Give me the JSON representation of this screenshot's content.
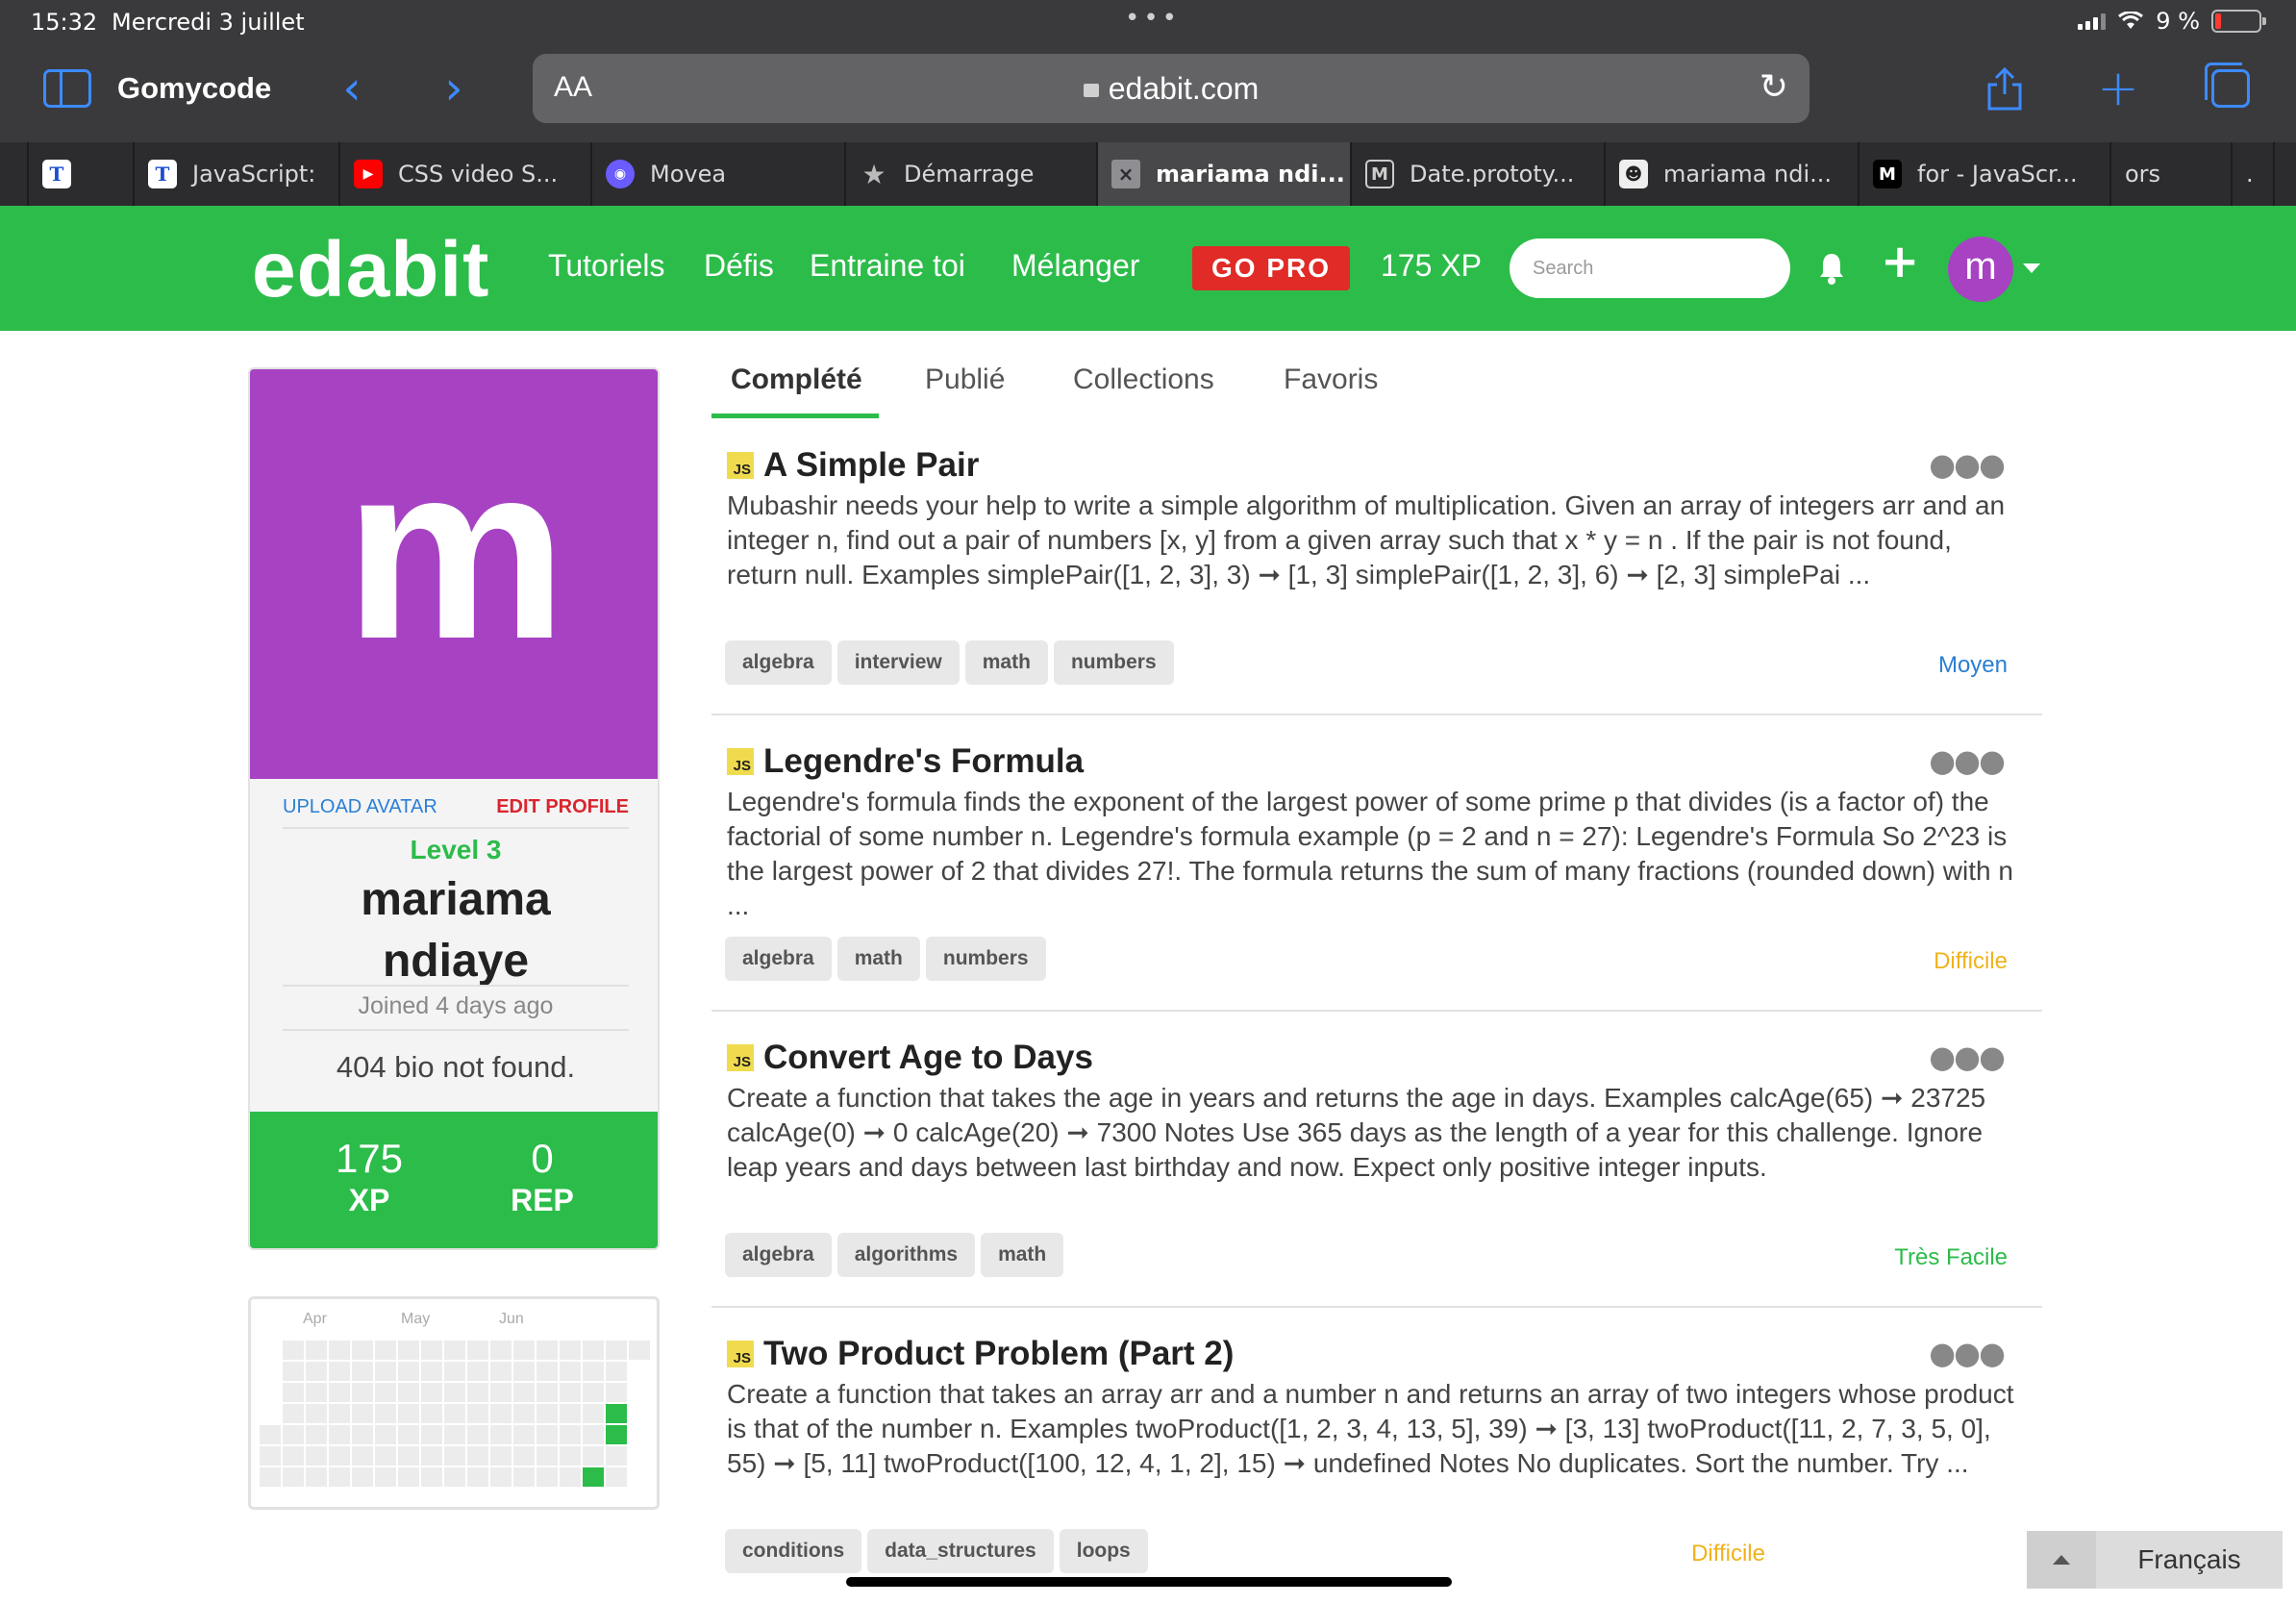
{
  "status_bar": {
    "time": "15:32",
    "date": "Mercredi 3 juillet",
    "battery": "9 %"
  },
  "browser": {
    "tab_group": "Gomycode",
    "url_aa": "AA",
    "url": "edabit.com",
    "tabs": [
      {
        "label": "",
        "favicon": "t-icon"
      },
      {
        "label": "JavaScript:",
        "favicon": "t-icon"
      },
      {
        "label": "CSS video S...",
        "favicon": "youtube-icon"
      },
      {
        "label": "Movea",
        "favicon": "movea-icon"
      },
      {
        "label": "Démarrage",
        "favicon": "star-icon"
      },
      {
        "label": "mariama ndi...",
        "favicon": "edabit-icon"
      },
      {
        "label": "Date.prototy...",
        "favicon": "m-icon"
      },
      {
        "label": "mariama ndi...",
        "favicon": "avatar-icon"
      },
      {
        "label": "for - JavaScr...",
        "favicon": "mdn-icon"
      },
      {
        "label": "ors",
        "favicon": ""
      },
      {
        "label": ".",
        "favicon": ""
      }
    ]
  },
  "site": {
    "logo": "edabit",
    "nav": [
      "Tutoriels",
      "Défis",
      "Entraine toi",
      "Mélanger"
    ],
    "go_pro": "GO PRO",
    "xp": "175 XP",
    "search_placeholder": "Search",
    "user_initial": "m",
    "brand_green": "#2cbc4a",
    "avatar_purple": "#a742c3"
  },
  "profile": {
    "initial": "m",
    "upload_avatar": "UPLOAD AVATAR",
    "edit_profile": "EDIT PROFILE",
    "level": "Level 3",
    "name_line1": "mariama",
    "name_line2": "ndiaye",
    "joined": "Joined 4 days ago",
    "bio": "404 bio not found.",
    "xp_value": "175",
    "xp_label": "XP",
    "rep_value": "0",
    "rep_label": "REP"
  },
  "activity": {
    "months": [
      "Apr",
      "May",
      "Jun"
    ]
  },
  "content_tabs": [
    "Complété",
    "Publié",
    "Collections",
    "Favoris"
  ],
  "challenges": [
    {
      "lang": "JS",
      "title": "A Simple Pair",
      "description": "Mubashir needs your help to write a simple algorithm of multiplication. Given an array of integers arr and an integer n, find out a pair of numbers [x, y] from a given array such that x * y = n . If the pair is not found, return null. Examples simplePair([1, 2, 3], 3) ➞ [1, 3] simplePair([1, 2, 3], 6) ➞ [2, 3] simplePai ...",
      "tags": [
        "algebra",
        "interview",
        "math",
        "numbers"
      ],
      "difficulty": "Moyen",
      "difficulty_color": "#2a7fd4"
    },
    {
      "lang": "JS",
      "title": "Legendre's Formula",
      "description": "Legendre's formula finds the exponent of the largest power of some prime p that divides (is a factor of) the factorial of some number n. Legendre's formula example (p = 2 and n = 27): Legendre's Formula So 2^23 is the largest power of 2 that divides 27!. The formula returns the sum of many fractions (rounded down) with n ...",
      "tags": [
        "algebra",
        "math",
        "numbers"
      ],
      "difficulty": "Difficile",
      "difficulty_color": "#f0b21b"
    },
    {
      "lang": "JS",
      "title": "Convert Age to Days",
      "description": "Create a function that takes the age in years and returns the age in days. Examples calcAge(65) ➞ 23725 calcAge(0) ➞ 0 calcAge(20) ➞ 7300 Notes Use 365 days as the length of a year for this challenge. Ignore leap years and days between last birthday and now. Expect only positive integer inputs.",
      "tags": [
        "algebra",
        "algorithms",
        "math"
      ],
      "difficulty": "Très Facile",
      "difficulty_color": "#2cbc4a"
    },
    {
      "lang": "JS",
      "title": "Two Product Problem (Part 2)",
      "description": "Create a function that takes an array arr and a number n and returns an array of two integers whose product is that of the number n. Examples twoProduct([1, 2, 3, 4, 13, 5], 39) ➞ [3, 13] twoProduct([11, 2, 7, 3, 5, 0], 55) ➞ [5, 11] twoProduct([100, 12, 4, 1, 2], 15) ➞ undefined Notes No duplicates. Sort the number. Try ...",
      "tags": [
        "conditions",
        "data_structures",
        "loops"
      ],
      "difficulty": "Difficile",
      "difficulty_color": "#f0b21b"
    }
  ],
  "language_switch": "Français"
}
